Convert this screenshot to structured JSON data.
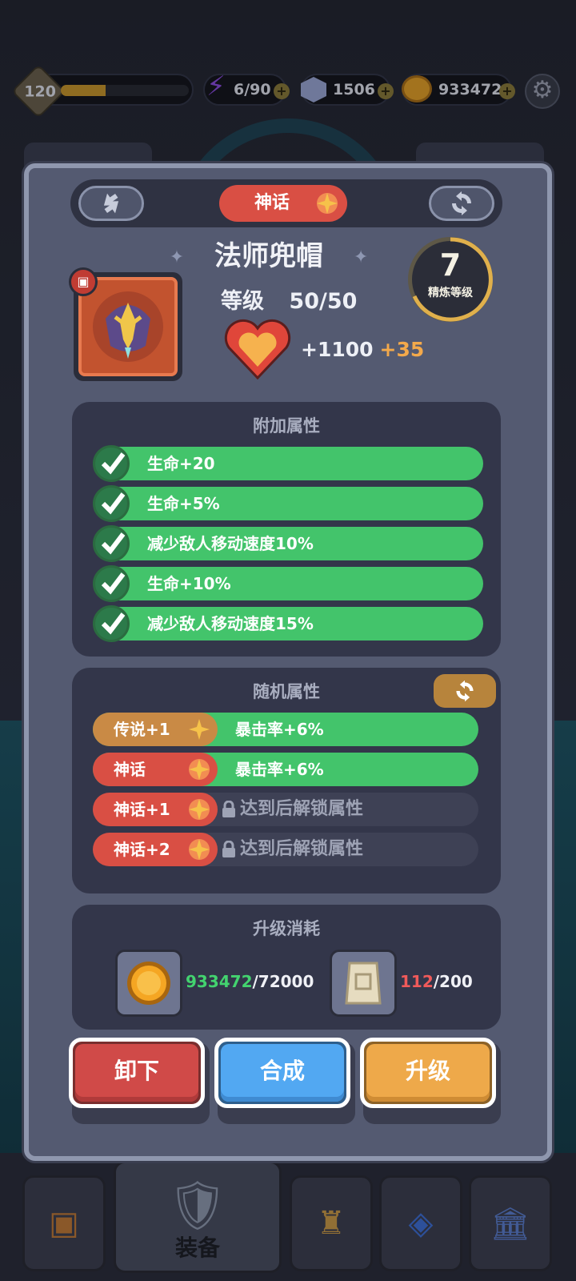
{
  "topbar": {
    "player_level": "120",
    "xp_fraction": 0.35,
    "energy": "6/90",
    "gems": "1506",
    "coins": "933472"
  },
  "bottom_nav": {
    "active_label": "装备"
  },
  "modal": {
    "rarity": "神话",
    "item_name": "法师兜帽",
    "level_label": "等级",
    "level_value": "50/50",
    "stat_value": "+1100",
    "stat_bonus": "+35",
    "refine_level": "7",
    "refine_label": "精炼等级",
    "extra_attrs_title": "附加属性",
    "extra_attrs": [
      "生命+20",
      "生命+5%",
      "减少敌人移动速度10%",
      "生命+10%",
      "减少敌人移动速度15%"
    ],
    "random_attrs_title": "随机属性",
    "random_attrs": [
      {
        "tag": "传说+1",
        "text": "暴击率+6%"
      },
      {
        "tag": "神话",
        "text": "暴击率+6%"
      },
      {
        "tag": "神话+1",
        "text": "达到后解锁属性"
      },
      {
        "tag": "神话+2",
        "text": "达到后解锁属性"
      }
    ],
    "upgrade_cost_title": "升级消耗",
    "cost_coins_have": "933472",
    "cost_coins_need": "/72000",
    "cost_scroll_have": "112",
    "cost_scroll_need": "/200",
    "buttons": {
      "unequip": "卸下",
      "combine": "合成",
      "upgrade": "升级"
    }
  },
  "colors": {
    "mythic": "#d94f44",
    "legendary": "#c98a45",
    "attr_green": "#43c46b",
    "upgrade_orange": "#eea94a",
    "combine_blue": "#52a8f2"
  }
}
